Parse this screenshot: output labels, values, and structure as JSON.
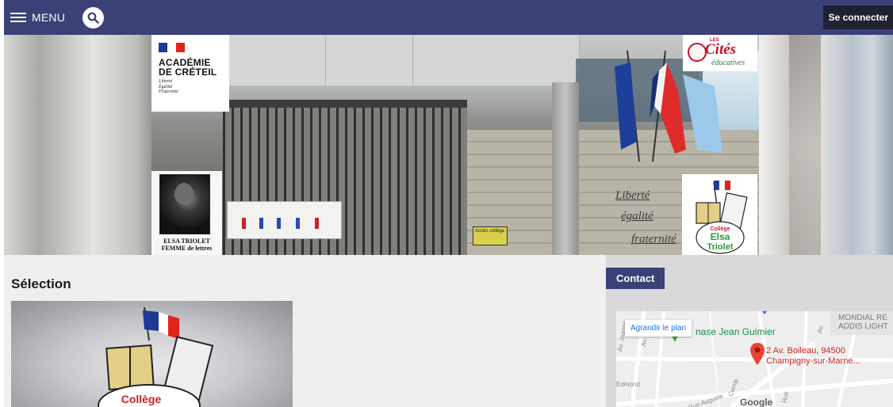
{
  "nav": {
    "menu_label": "MENU",
    "login_label": "Se connecter",
    "bar_color": "#3b4077"
  },
  "banner": {
    "academie": {
      "title_line1": "ACADÉMIE",
      "title_line2": "DE CRÉTEIL",
      "motto_line1": "Liberté",
      "motto_line2": "Égalité",
      "motto_line3": "Fraternité"
    },
    "elsa": {
      "caption_line1": "ELSA TRIOLET",
      "caption_line2": "FEMME de lettres"
    },
    "cites": {
      "les": "LES",
      "name": "Cités",
      "sub": "éducatives"
    },
    "wall": {
      "line1": "Liberté",
      "line2": "égalité",
      "line3": "fraternité"
    },
    "college_logo": {
      "line1": "Collège",
      "line2": "Elsa",
      "line3": "Triolet"
    },
    "access_sign": "Accès collège"
  },
  "selection": {
    "title": "Sélection",
    "thumb_label": "Collège"
  },
  "contact": {
    "title": "Contact",
    "map": {
      "enlarge_label": "Agrandir le plan",
      "gym": "nase Jean Guimier",
      "address_line1": "2 Av. Boileau, 94500",
      "address_line2": "Champigny-sur-Marne...",
      "poi_line1": "MONDIAL RE",
      "poi_line2": "ADDIS LIGHT",
      "google": "Google",
      "street_jeanne": "Av. Jeanne",
      "street_bois": "Av. du Bo",
      "street_edmond": "Edmond",
      "street_auguste": "Rue Auguste",
      "street_comte": "Comte",
      "street_rue": "Rue",
      "street_av": "Av."
    }
  }
}
